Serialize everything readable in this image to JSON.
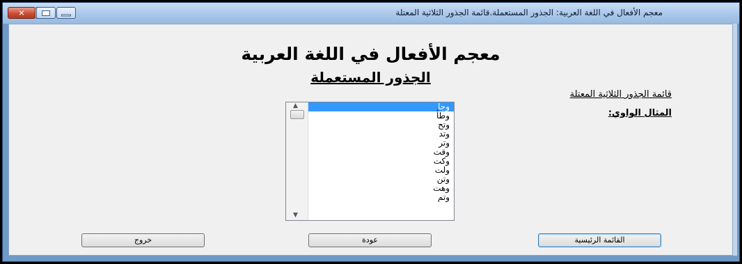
{
  "window": {
    "title": "معجم الأفعال في اللغة العربية: الجذور المستعملة.قائمة الجذور الثلاثية المعتلة"
  },
  "main": {
    "heading": "معجم الأفعال في اللغة العربية",
    "subheading": "الجذور المستعملة",
    "list_label": "قائمة الجذور الثلاثية المعتلة",
    "type_label": "المثال الواوي:"
  },
  "roots_list": {
    "items": [
      "وجأ",
      "وطأ",
      "وتح",
      "وتد",
      "وتر",
      "وقت",
      "وكت",
      "ولت",
      "وتن",
      "وهت",
      "وتم"
    ],
    "selected_index": 0
  },
  "buttons": {
    "exit": "خروج",
    "back": "عودة",
    "main_menu": "القائمة الرئيسية"
  },
  "icons": {
    "app": "app-icon",
    "close": "close-icon",
    "maximize": "maximize-icon",
    "minimize": "minimize-icon",
    "scroll_up": "scroll-up-arrow-icon",
    "scroll_down": "scroll-down-arrow-icon"
  },
  "colors": {
    "selection": "#3399ff",
    "window_frame": "#6f99c6",
    "close_button": "#c74a33"
  }
}
